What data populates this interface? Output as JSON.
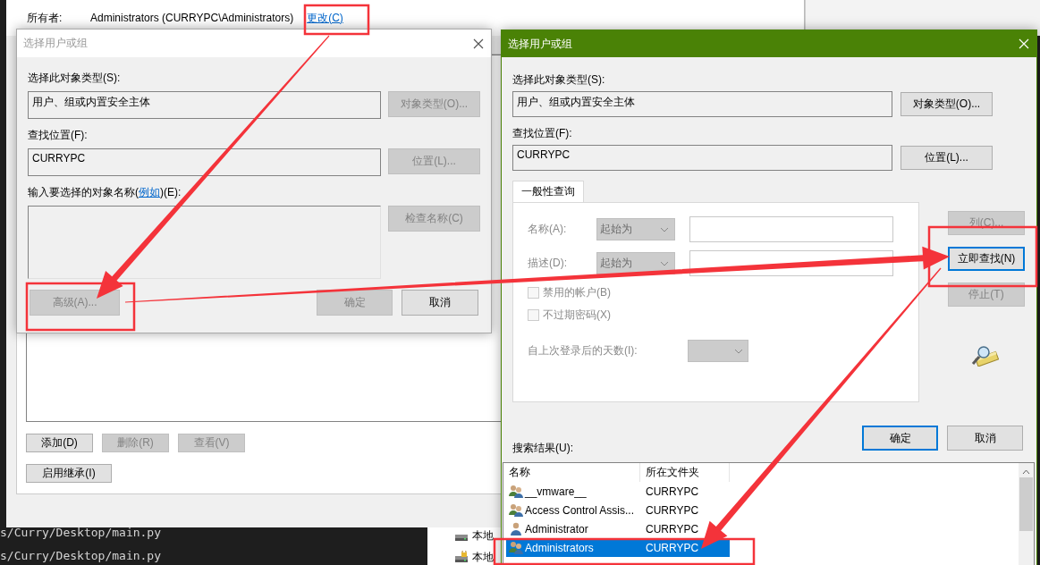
{
  "desktop": {
    "terminal_lines": [
      "s/Curry/Desktop/main.py",
      "s/Curry/Desktop/main.py"
    ],
    "explorer_items": [
      {
        "label": "本地",
        "locked": false
      },
      {
        "label": "本地",
        "locked": true
      }
    ]
  },
  "properties_window": {
    "owner_label": "所有者:",
    "owner_value": "Administrators (CURRYPC\\Administrators)",
    "change_link": "更改(C)",
    "buttons": [
      {
        "label": "添加(D)",
        "disabled": false
      },
      {
        "label": "删除(R)",
        "disabled": true
      },
      {
        "label": "查看(V)",
        "disabled": true
      }
    ],
    "inherit_button": {
      "label": "启用继承(I)",
      "disabled": false
    }
  },
  "select_dialog": {
    "title": "选择用户或组",
    "active": false,
    "object_type_label": "选择此对象类型(S):",
    "object_type_value": "用户、组或内置安全主体",
    "object_type_button": {
      "label": "对象类型(O)...",
      "disabled": true
    },
    "location_label": "查找位置(F):",
    "location_value": "CURRYPC",
    "location_button": {
      "label": "位置(L)...",
      "disabled": true
    },
    "names_label": {
      "before": "输入要选择的对象名称(",
      "link": "例如",
      "after": ")(E):"
    },
    "check_names_button": {
      "label": "检查名称(C)",
      "disabled": true
    },
    "buttons": [
      {
        "label": "高级(A)...",
        "disabled": true
      },
      {
        "label": "确定",
        "disabled": true
      },
      {
        "label": "取消",
        "disabled": false
      }
    ]
  },
  "advanced_dialog": {
    "title": "选择用户或组",
    "active": true,
    "object_type_label": "选择此对象类型(S):",
    "object_type_value": "用户、组或内置安全主体",
    "object_type_button": {
      "label": "对象类型(O)...",
      "disabled": false
    },
    "location_label": "查找位置(F):",
    "location_value": "CURRYPC",
    "location_button": {
      "label": "位置(L)...",
      "disabled": false
    },
    "tabs": [
      {
        "label": "一般性查询",
        "selected": true
      }
    ],
    "query_fields": [
      {
        "label": "名称(A):",
        "operator": "起始为",
        "disabled": true
      },
      {
        "label": "描述(D):",
        "operator": "起始为",
        "disabled": true
      }
    ],
    "checkboxes": [
      {
        "label": "禁用的帐户(B)",
        "checked": false,
        "disabled": true
      },
      {
        "label": "不过期密码(X)",
        "checked": false,
        "disabled": true
      }
    ],
    "days_label": "自上次登录后的天数(I):",
    "side_buttons": [
      {
        "label": "列(C)...",
        "disabled": true,
        "focused": false
      },
      {
        "label": "立即查找(N)",
        "disabled": false,
        "focused": true
      },
      {
        "label": "停止(T)",
        "disabled": true,
        "focused": false
      }
    ],
    "buttons": [
      {
        "label": "确定",
        "disabled": false,
        "default": true
      },
      {
        "label": "取消",
        "disabled": false,
        "default": false
      }
    ],
    "results_label": "搜索结果(U):",
    "results": {
      "columns": [
        "名称",
        "所在文件夹"
      ],
      "rows": [
        {
          "name": "__vmware__",
          "folder": "CURRYPC",
          "kind": "group",
          "selected": false
        },
        {
          "name": "Access Control Assis...",
          "folder": "CURRYPC",
          "kind": "group",
          "selected": false
        },
        {
          "name": "Administrator",
          "folder": "CURRYPC",
          "kind": "user",
          "selected": false
        },
        {
          "name": "Administrators",
          "folder": "CURRYPC",
          "kind": "group",
          "selected": true
        }
      ]
    }
  },
  "annotations": [
    {
      "kind": "box"
    },
    {
      "kind": "box"
    },
    {
      "kind": "box"
    },
    {
      "kind": "box"
    },
    {
      "kind": "arrow"
    },
    {
      "kind": "arrow"
    },
    {
      "kind": "arrow"
    }
  ]
}
